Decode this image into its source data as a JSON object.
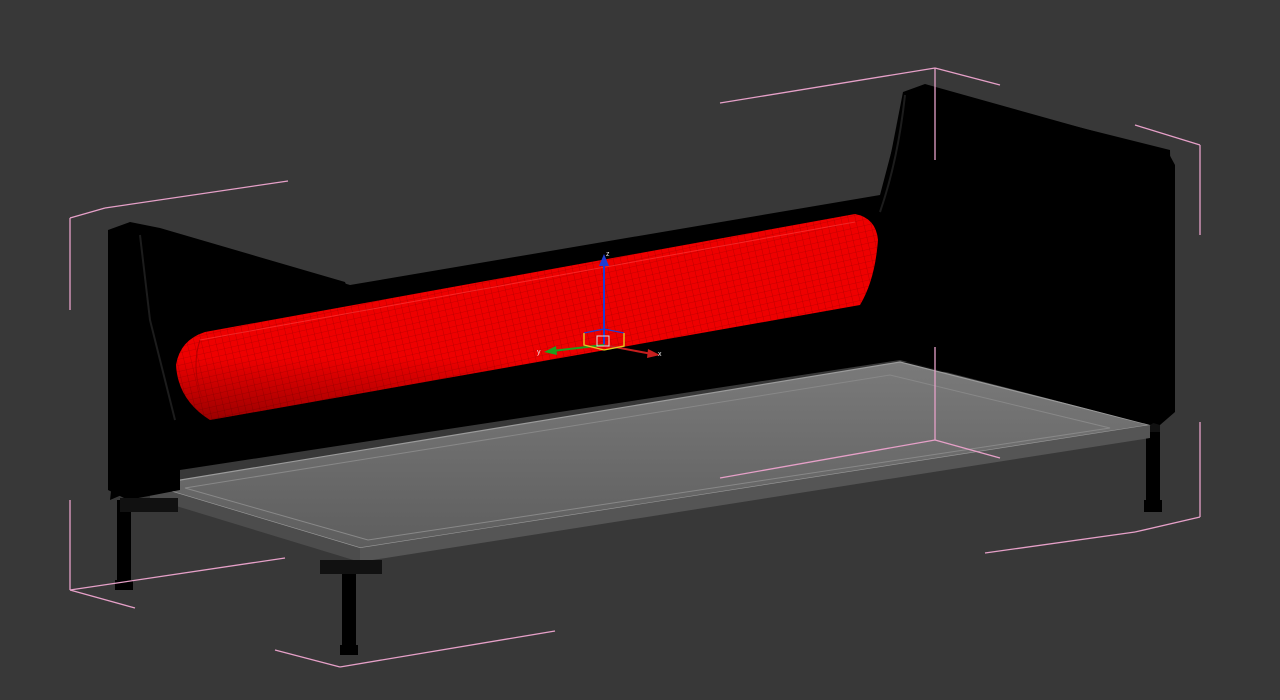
{
  "viewport": {
    "background": "#383838",
    "object": "sofa",
    "selection_color": "#e6a0c8",
    "selected_mesh_color": "#e00000",
    "base_color": "#6a6a6a",
    "frame_color": "#000000"
  },
  "gizmo": {
    "x_label": "x",
    "y_label": "y",
    "z_label": "z",
    "x_color": "#c81e1e",
    "y_color": "#1ea01e",
    "z_color": "#1e3cd2",
    "plane_color": "#e6c81e"
  },
  "icons": [
    "move-gizmo-icon"
  ]
}
